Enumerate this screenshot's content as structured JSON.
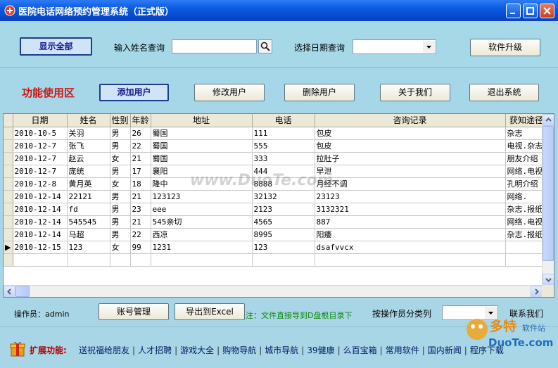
{
  "window": {
    "title": "医院电话网络预约管理系统（正式版）"
  },
  "toolbar": {
    "show_all": "显示全部",
    "name_search_label": "输入姓名查询",
    "name_search_value": "",
    "date_search_label": "选择日期查询",
    "date_search_value": "",
    "upgrade": "软件升级"
  },
  "functions": {
    "title": "功能使用区",
    "add_user": "添加用户",
    "edit_user": "修改用户",
    "delete_user": "删除用户",
    "about": "关于我们",
    "exit": "退出系统"
  },
  "grid": {
    "columns": [
      "日期",
      "姓名",
      "性别",
      "年龄",
      "地址",
      "电话",
      "咨询记录",
      "获知途径"
    ],
    "rows": [
      [
        "2010-10-5",
        "关羽",
        "男",
        "26",
        "蜀国",
        "111",
        "包皮",
        "杂志"
      ],
      [
        "2010-12-7",
        "张飞",
        "男",
        "22",
        "蜀国",
        "555",
        "包皮",
        "电视.杂志"
      ],
      [
        "2010-12-7",
        "赵云",
        "女",
        "21",
        "蜀国",
        "333",
        "拉肚子",
        "朋友介绍"
      ],
      [
        "2010-12-7",
        "庞统",
        "男",
        "17",
        "襄阳",
        "444",
        "早泄",
        "网络.电视"
      ],
      [
        "2010-12-8",
        "黄月英",
        "女",
        "18",
        "隆中",
        "8888",
        "月经不调",
        "孔明介绍"
      ],
      [
        "2010-12-14",
        "22121",
        "男",
        "21",
        "123123",
        "32132",
        "23123",
        "网络."
      ],
      [
        "2010-12-14",
        "fd",
        "男",
        "23",
        "eee",
        "2123",
        "3132321",
        "杂志.报纸"
      ],
      [
        "2010-12-14",
        "545545",
        "男",
        "21",
        "545亲切",
        "4565",
        "887",
        "网络.电视"
      ],
      [
        "2010-12-14",
        "马超",
        "男",
        "22",
        "西凉",
        "8995",
        "阳痿",
        "杂志.报纸"
      ],
      [
        "2010-12-15",
        "123",
        "女",
        "99",
        "1231",
        "123",
        "dsafvvcx",
        ""
      ]
    ],
    "current_row_marker": "▶"
  },
  "bottom": {
    "operator": "操作员：admin",
    "account_mgmt": "账号管理",
    "export_excel": "导出到Excel",
    "note": "注：文件直接导到D盘根目录下",
    "by_operator_label": "按操作员分类列",
    "operator_select_value": "",
    "contact": "联系我们"
  },
  "extension": {
    "title": "扩展功能:",
    "links": [
      "送祝福给朋友",
      "人才招聘",
      "游戏大全",
      "购物导航",
      "城市导航",
      "39健康",
      "么百宝箱",
      "常用软件",
      "国内新闻",
      "程序下载"
    ]
  },
  "watermark": "www.DuoTe.com",
  "logo": {
    "line1": "多特",
    "line2": "软件站",
    "url": "DuoTe.com"
  },
  "colors": {
    "titlebar": "#0a5ae0",
    "panel": "#a9d6e6",
    "function_title": "#d11414",
    "note": "#0a8a0a"
  }
}
